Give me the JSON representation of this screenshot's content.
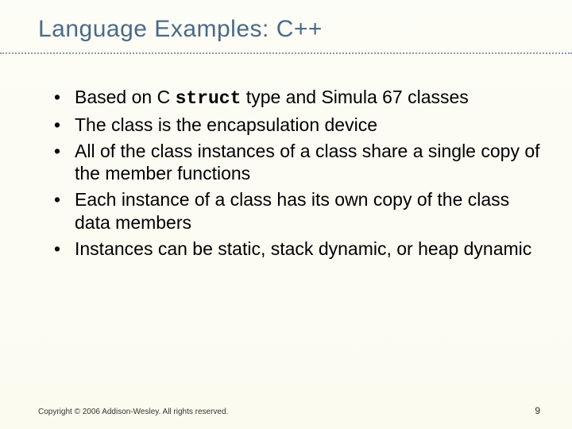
{
  "title": "Language Examples: C++",
  "bullets": [
    {
      "pre": "Based on C ",
      "code": "struct",
      "post": " type and Simula 67 classes"
    },
    {
      "pre": "The class is the encapsulation device",
      "code": "",
      "post": ""
    },
    {
      "pre": "All of the class instances of a class share a single copy of the member functions",
      "code": "",
      "post": ""
    },
    {
      "pre": "Each instance of a class has its own copy of the class data members",
      "code": "",
      "post": ""
    },
    {
      "pre": "Instances can be static, stack dynamic, or heap dynamic",
      "code": "",
      "post": ""
    }
  ],
  "footer": {
    "copyright": "Copyright © 2006 Addison-Wesley. All rights reserved.",
    "page": "9"
  }
}
